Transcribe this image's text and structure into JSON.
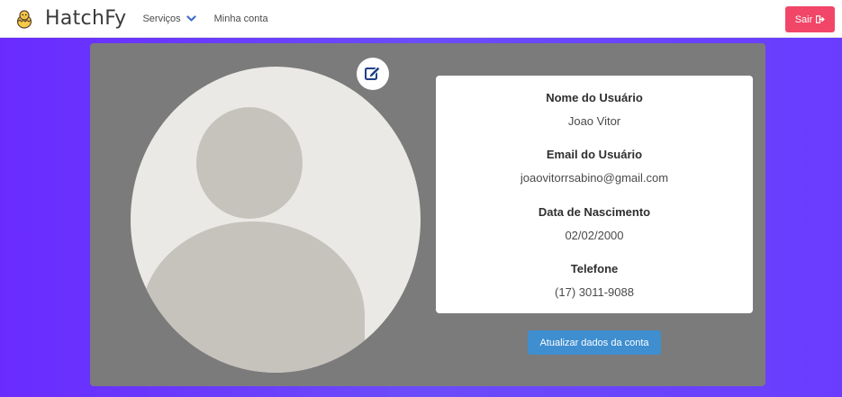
{
  "brand": {
    "name": "HatchFy",
    "logo_icon": "chick-icon"
  },
  "nav": {
    "services_label": "Serviços",
    "account_label": "Minha conta",
    "logout_label": "Sair",
    "logout_icon": "sign-out-icon"
  },
  "profile": {
    "avatar_icon": "user-avatar-icon",
    "edit_icon": "edit-icon",
    "fields": [
      {
        "label": "Nome do Usuário",
        "value": "Joao Vitor"
      },
      {
        "label": "Email do Usuário",
        "value": "joaovitorrsabino@gmail.com"
      },
      {
        "label": "Data de Nascimento",
        "value": "02/02/2000"
      },
      {
        "label": "Telefone",
        "value": "(17) 3011-9088"
      }
    ],
    "update_button_label": "Atualizar dados da conta"
  },
  "colors": {
    "background_gradient": "#6a2bff",
    "panel": "#7b7b7b",
    "logout_button": "#f14668",
    "update_button": "#3e8ed0",
    "nav_accent": "#3e6dd0"
  }
}
